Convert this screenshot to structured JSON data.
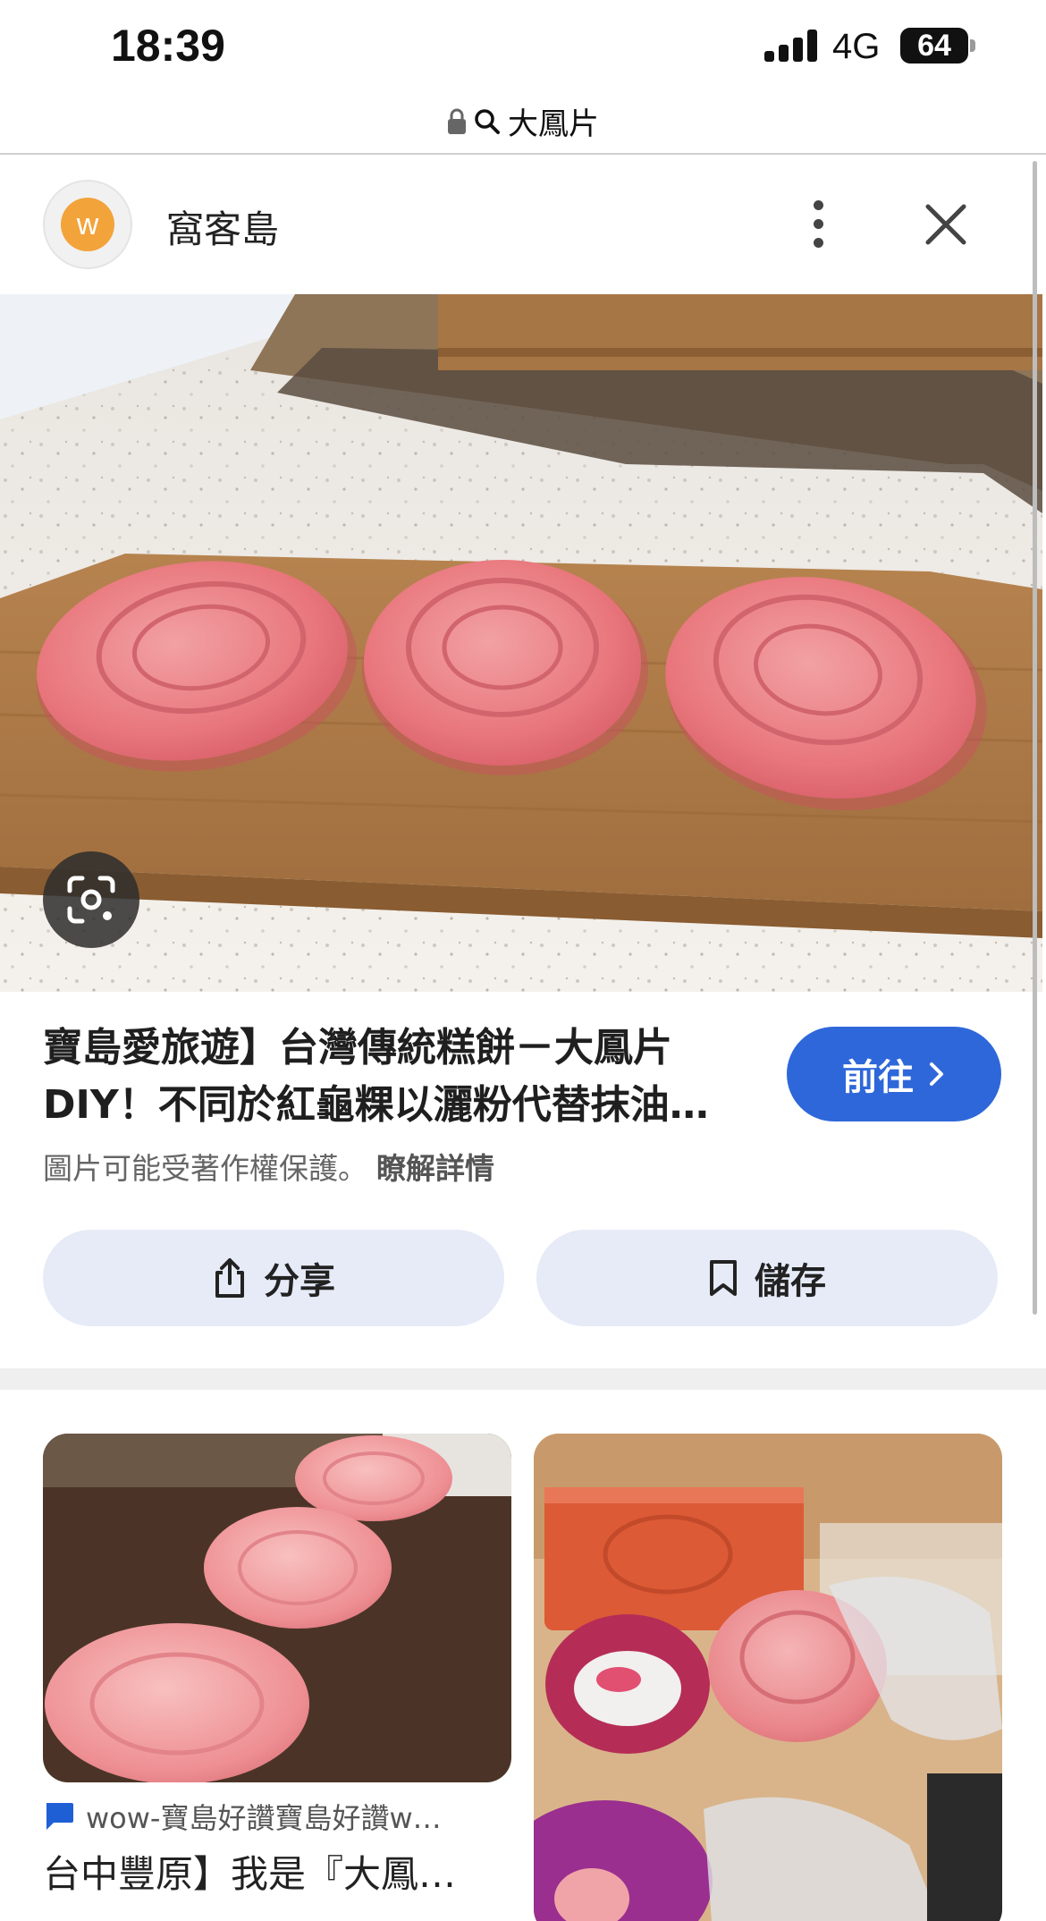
{
  "status": {
    "time": "18:39",
    "network": "4G",
    "battery": "64"
  },
  "url_bar": {
    "query": "大鳳片"
  },
  "source": {
    "avatar_letter": "w",
    "name": "窩客島"
  },
  "result": {
    "title_line1": "寶島愛旅遊】台灣傳統糕餅－大鳳片",
    "title_line2": "DIY！不同於紅龜粿以灑粉代替抹油…",
    "visit_label": "前往",
    "copyright_text": "圖片可能受著作權保護。",
    "learn_more": "瞭解詳情",
    "share_label": "分享",
    "save_label": "儲存"
  },
  "related": [
    {
      "source": "wow-寶島好讚寶島好讚w…",
      "title": "台中豐原】我是『大鳳…"
    }
  ],
  "colors": {
    "accent": "#2e67d9",
    "action_bg": "#e6ebf7",
    "cake_pink": "#e8767c"
  },
  "icons": [
    "lock-icon",
    "search-icon",
    "more-vert-icon",
    "close-icon",
    "lens-icon",
    "chevron-right-icon",
    "share-icon",
    "bookmark-icon",
    "site-favicon"
  ]
}
